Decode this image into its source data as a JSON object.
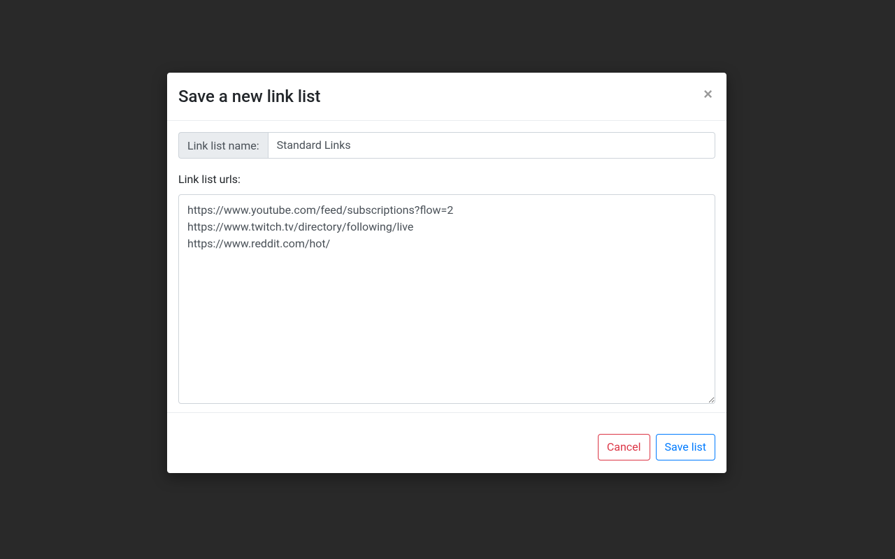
{
  "modal": {
    "title": "Save a new link list",
    "name_label": "Link list name:",
    "name_value": "Standard Links",
    "urls_label": "Link list urls:",
    "urls_value": "https://www.youtube.com/feed/subscriptions?flow=2\nhttps://www.twitch.tv/directory/following/live\nhttps://www.reddit.com/hot/",
    "cancel_label": "Cancel",
    "save_label": "Save list"
  }
}
